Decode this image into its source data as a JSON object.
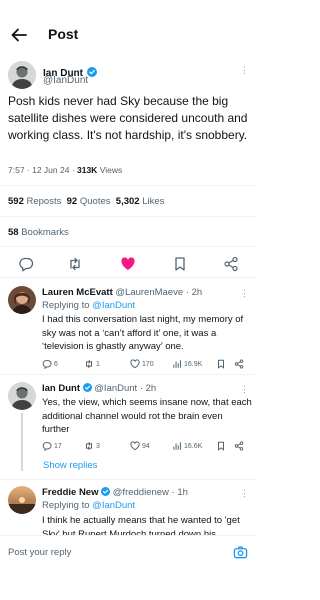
{
  "header": {
    "title": "Post"
  },
  "main_tweet": {
    "author": "Ian Dunt",
    "handle": "@IanDunt",
    "text": "Posh kids never had Sky because the big satellite dishes were considered uncouth and working class. It's not hardship, it's snobbery.",
    "time": "7:57 · 12 Jun 24 · ",
    "views_count": "313K",
    "views_label": " Views",
    "reposts_count": "592",
    "reposts_label": "Reposts",
    "quotes_count": "92",
    "quotes_label": "Quotes",
    "likes_count": "5,302",
    "likes_label": "Likes",
    "bookmarks_count": "58",
    "bookmarks_label": "Bookmarks"
  },
  "replies": [
    {
      "author": "Lauren McEvatt",
      "handle": "@LaurenMaeve · 2h",
      "replying_prefix": "Replying to ",
      "replying_to": "@IanDunt",
      "text": "I had this conversation last night, my memory of sky was not a ‘can’t afford it’ one, it was a ‘television is ghastly anyway’ one.",
      "replies": "6",
      "reposts": "1",
      "likes": "170",
      "views": "16.9K"
    },
    {
      "author": "Ian Dunt",
      "handle": "@IanDunt · 2h",
      "text": "Yes, the view, which seems insane now, that each additional channel would rot the brain even further",
      "replies": "17",
      "reposts": "3",
      "likes": "94",
      "views": "16.6K"
    },
    {
      "author": "Freddie New",
      "handle": "@freddienew · 1h",
      "replying_prefix": "Replying to ",
      "replying_to": "@IanDunt",
      "text": "I think he actually means that he wanted to 'get Sky' but Rupert Murdoch turned down his"
    }
  ],
  "show_replies": "Show replies",
  "composer": {
    "placeholder": "Post your reply"
  },
  "colors": {
    "accent": "#1d9bf0",
    "like": "#f91880",
    "text": "#0f1419",
    "muted": "#536471"
  }
}
